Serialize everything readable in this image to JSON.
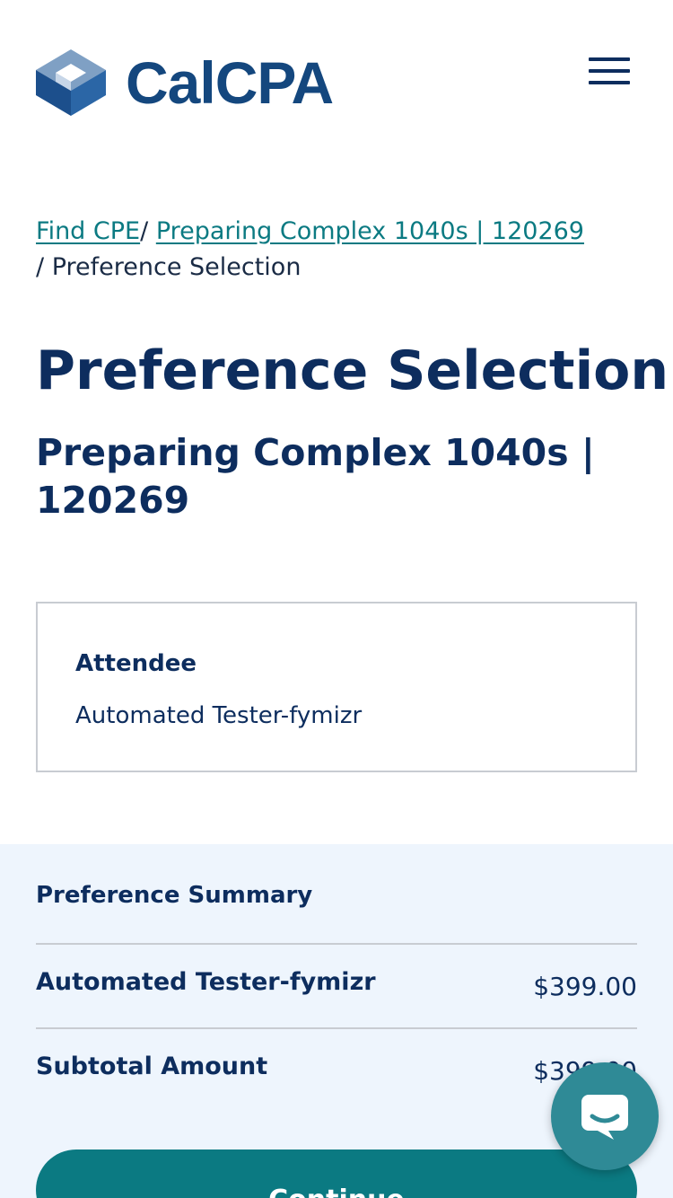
{
  "header": {
    "brand": "CalCPA",
    "logo_icon": "calcpa-cube-logo",
    "menu_icon": "hamburger-menu-icon"
  },
  "breadcrumb": {
    "items": [
      {
        "label": "Find CPE"
      },
      {
        "label": "Preparing Complex 1040s | 120269"
      }
    ],
    "separator": "/",
    "current": "Preference Selection"
  },
  "page": {
    "title": "Preference Selection",
    "subtitle": "Preparing Complex 1040s | 120269"
  },
  "attendee": {
    "label": "Attendee",
    "name": "Automated Tester-fymizr"
  },
  "summary": {
    "title": "Preference Summary",
    "rows": [
      {
        "label": "Automated Tester-fymizr",
        "value": "$399.00"
      },
      {
        "label": "Subtotal Amount",
        "value": "$399.00"
      }
    ]
  },
  "actions": {
    "continue_label": "Continue"
  },
  "chat": {
    "icon": "chat-bubble-icon"
  },
  "colors": {
    "navy": "#0d2d5e",
    "teal": "#0b7a82",
    "summary_bg": "#eef5fd",
    "chat": "#2f8a96"
  }
}
